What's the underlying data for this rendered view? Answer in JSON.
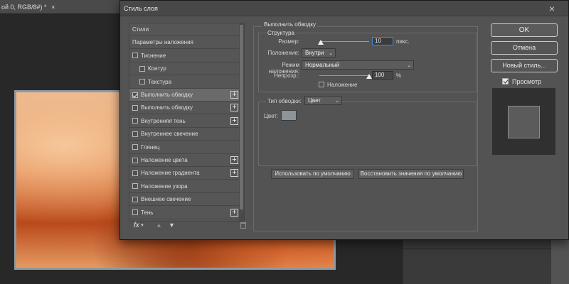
{
  "document": {
    "tab_label": "ой 0, RGB/8#) *",
    "tab_close": "×"
  },
  "dialog": {
    "title": "Стиль слоя",
    "close": "×",
    "style_list": [
      {
        "label": "Стили",
        "checkbox": false,
        "indent": 0,
        "plus": false,
        "selected": false
      },
      {
        "label": "Параметры наложения",
        "checkbox": false,
        "indent": 0,
        "plus": false,
        "selected": false
      },
      {
        "label": "Тиснение",
        "checkbox": true,
        "checked": false,
        "indent": 0,
        "plus": false
      },
      {
        "label": "Контур",
        "checkbox": true,
        "checked": false,
        "indent": 1,
        "plus": false
      },
      {
        "label": "Текстура",
        "checkbox": true,
        "checked": false,
        "indent": 1,
        "plus": false
      },
      {
        "label": "Выполнить обводку",
        "checkbox": true,
        "checked": true,
        "indent": 0,
        "plus": true,
        "selected": true
      },
      {
        "label": "Выполнить обводку",
        "checkbox": true,
        "checked": false,
        "indent": 0,
        "plus": true
      },
      {
        "label": "Внутренняя тень",
        "checkbox": true,
        "checked": false,
        "indent": 0,
        "plus": true
      },
      {
        "label": "Внутреннее свечение",
        "checkbox": true,
        "checked": false,
        "indent": 0,
        "plus": false
      },
      {
        "label": "Глянец",
        "checkbox": true,
        "checked": false,
        "indent": 0,
        "plus": false
      },
      {
        "label": "Наложение цвета",
        "checkbox": true,
        "checked": false,
        "indent": 0,
        "plus": true
      },
      {
        "label": "Наложение градиента",
        "checkbox": true,
        "checked": false,
        "indent": 0,
        "plus": true
      },
      {
        "label": "Наложение узора",
        "checkbox": true,
        "checked": false,
        "indent": 0,
        "plus": false
      },
      {
        "label": "Внешнее свечение",
        "checkbox": true,
        "checked": false,
        "indent": 0,
        "plus": false
      },
      {
        "label": "Тень",
        "checkbox": true,
        "checked": false,
        "indent": 0,
        "plus": true
      }
    ],
    "footer": {
      "fx": "fx"
    },
    "settings": {
      "section_title": "Выполнить обводку",
      "structure_title": "Структура",
      "size_label": "Размер:",
      "size_value": "10",
      "size_unit": "пикс.",
      "size_fraction": 0.03,
      "position_label": "Положение:",
      "position_value": "Внутри",
      "blend_label": "Режим наложения:",
      "blend_value": "Нормальный",
      "opacity_label": "Непрозр.:",
      "opacity_value": "100",
      "opacity_unit": "%",
      "opacity_fraction": 1.0,
      "overprint_label": "Наложение",
      "fill_type_label": "Тип обводки:",
      "fill_type_value": "Цвет",
      "color_label": "Цвет:",
      "color_value": "#8e9397",
      "make_default": "Использовать по умолчанию",
      "reset_default": "Восстановить значения по умолчанию"
    },
    "buttons": {
      "ok": "OK",
      "cancel": "Отмена",
      "new_style": "Новый стиль...",
      "preview_label": "Просмотр",
      "preview_checked": true
    }
  }
}
